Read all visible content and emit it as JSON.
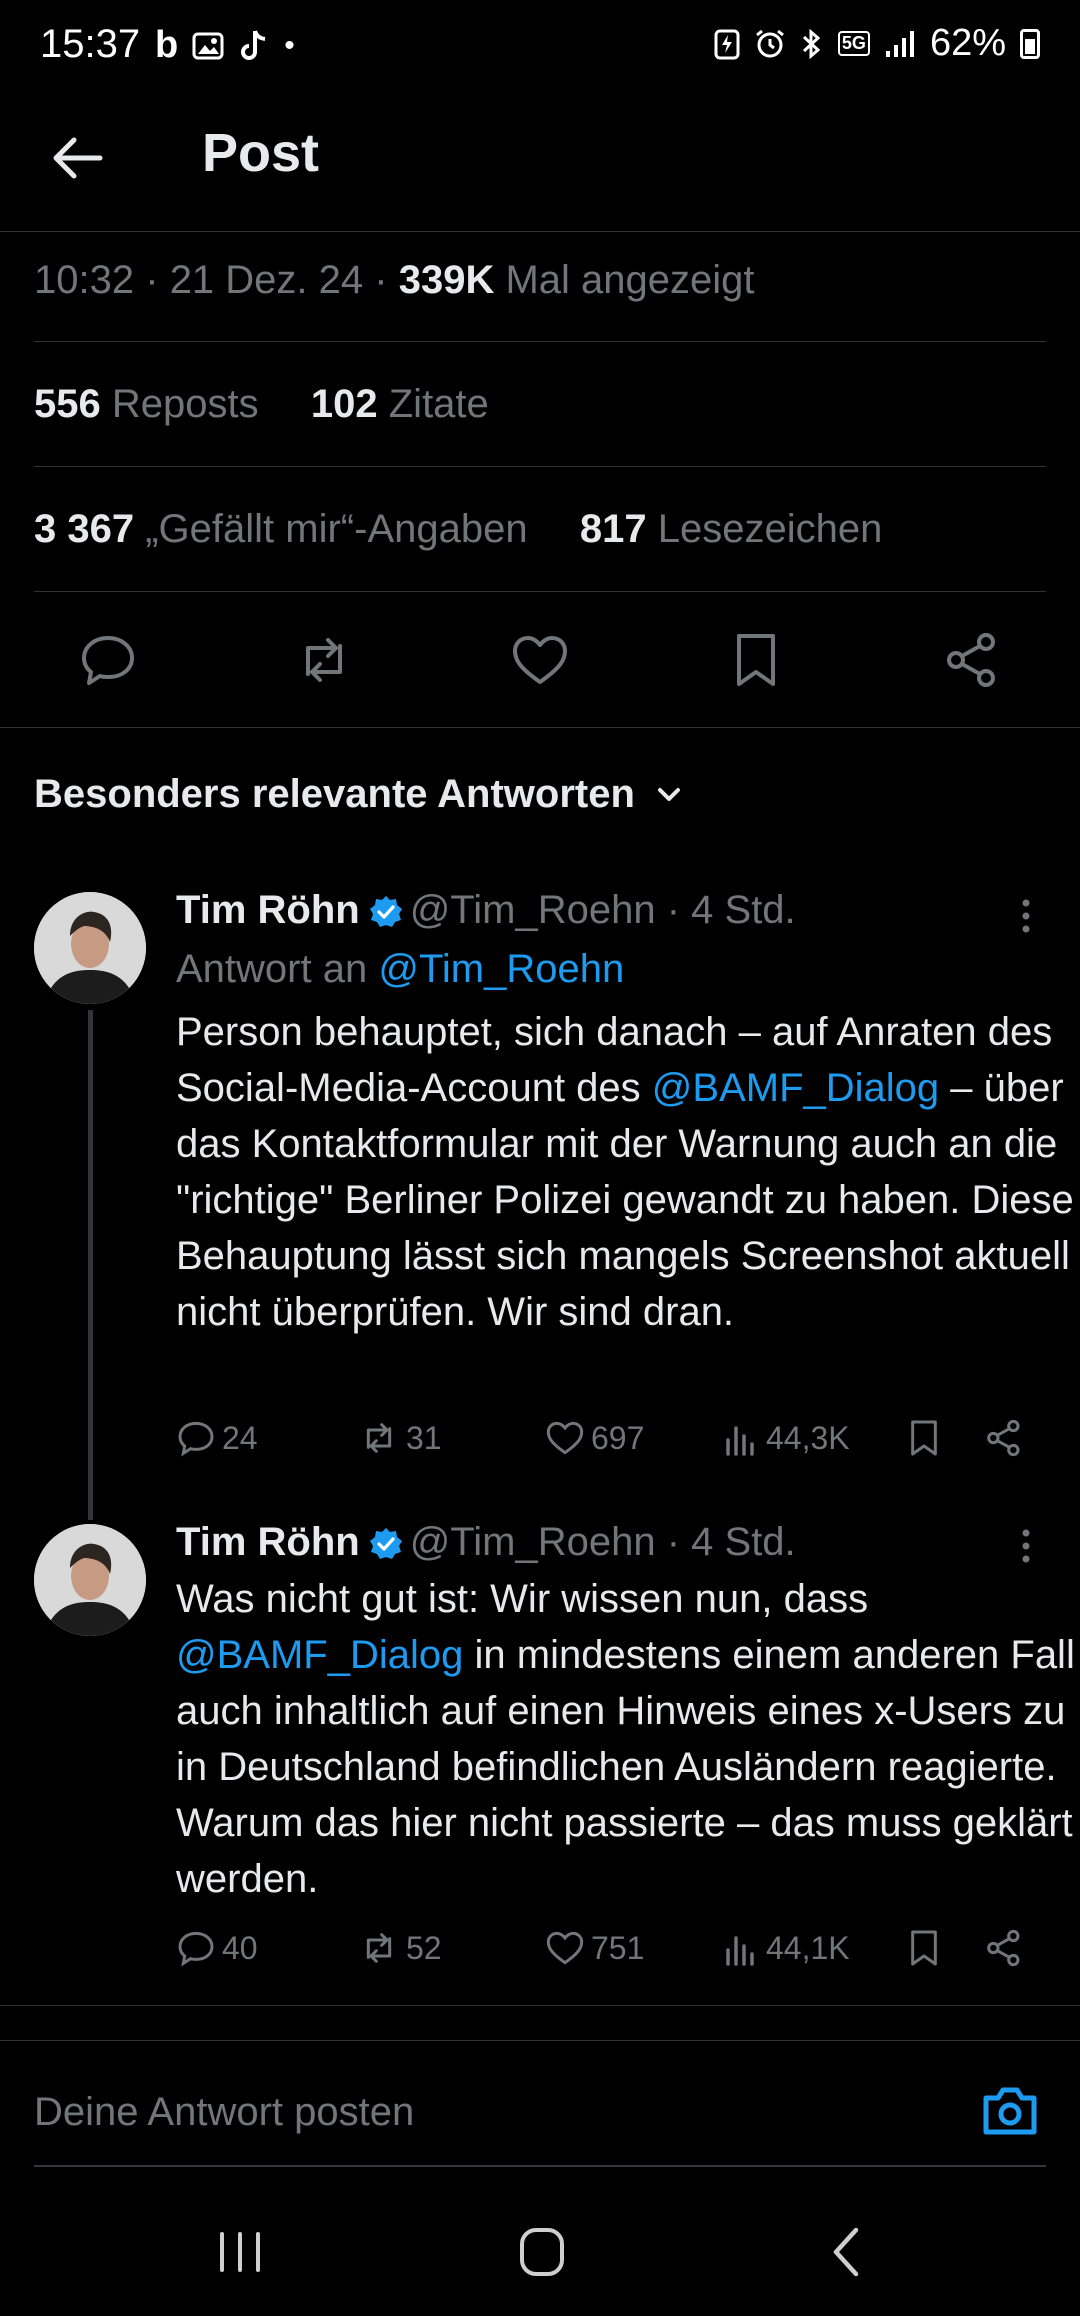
{
  "status_bar": {
    "time": "15:37",
    "network": "5G",
    "battery": "62%"
  },
  "header": {
    "title": "Post"
  },
  "post_meta": {
    "time": "10:32",
    "date": "21 Dez. 24",
    "views_count": "339K",
    "views_label": "Mal angezeigt",
    "sep": "·"
  },
  "stats": {
    "reposts_count": "556",
    "reposts_label": "Reposts",
    "quotes_count": "102",
    "quotes_label": "Zitate",
    "likes_count": "3 367",
    "likes_label": "„Gefällt mir“-Angaben",
    "bookmarks_count": "817",
    "bookmarks_label": "Lesezeichen"
  },
  "sort": {
    "label": "Besonders relevante Antworten"
  },
  "replies": [
    {
      "name": "Tim Röhn",
      "handle": "@Tim_Roehn",
      "time": "· 4 Std.",
      "reply_prefix": "Antwort an",
      "reply_to": "@Tim_Roehn",
      "text_part1": "Person behauptet, sich danach – auf Anraten des Social-Media-Account des",
      "mention": "@BAMF_Dialog",
      "text_part2": "– über das Kontaktformular mit der Warnung auch an die \"richtige\" Berliner Polizei gewandt zu haben. Diese Behauptung lässt sich mangels Screenshot aktuell nicht überprüfen. Wir sind dran.",
      "replies": "24",
      "reposts": "31",
      "likes": "697",
      "views": "44,3K"
    },
    {
      "name": "Tim Röhn",
      "handle": "@Tim_Roehn",
      "time": "· 4 Std.",
      "text_part1": "Was nicht gut ist: Wir wissen nun, dass",
      "mention": "@BAMF_Dialog",
      "text_part2": "in mindestens einem anderen Fall auch inhaltlich auf einen Hinweis eines x-Users zu in Deutschland befindlichen Ausländern reagierte. Warum das hier nicht passierte – das muss geklärt werden.",
      "replies": "40",
      "reposts": "52",
      "likes": "751",
      "views": "44,1K"
    }
  ],
  "compose": {
    "placeholder": "Deine Antwort posten"
  },
  "colors": {
    "accent": "#1d9bf0",
    "muted": "#71767b",
    "text": "#e7e9ea",
    "background": "#000000"
  }
}
